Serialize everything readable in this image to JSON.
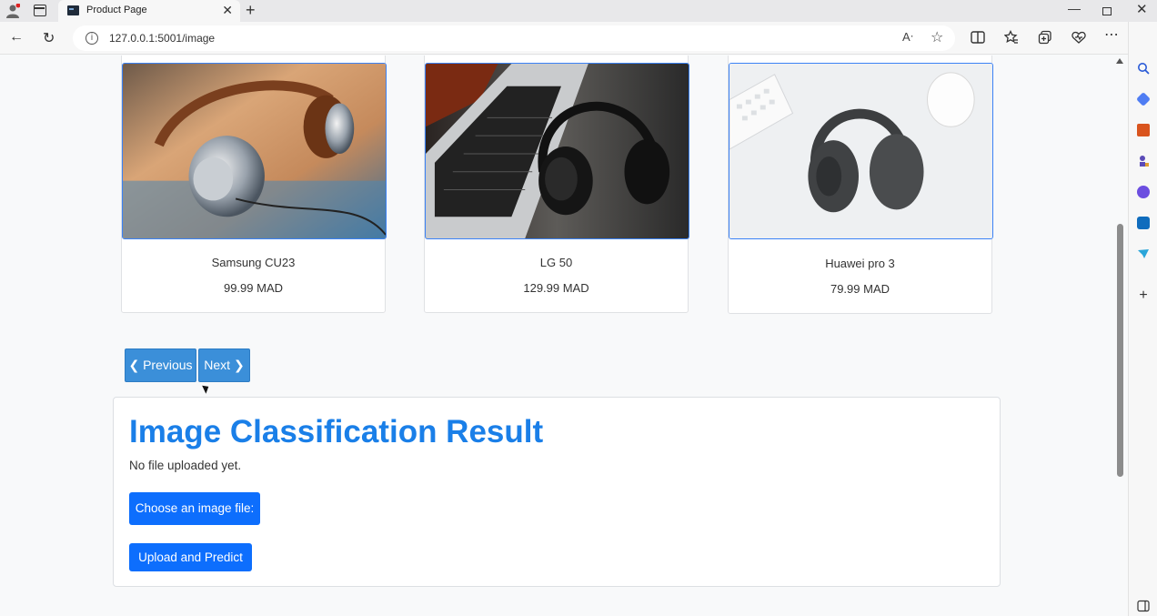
{
  "browser": {
    "tab_title": "Product Page",
    "url": "127.0.0.1:5001/image",
    "tab_close_glyph": "✕",
    "new_tab_glyph": "+",
    "window_controls": {
      "minimize": "—",
      "close": "✕"
    },
    "nav_glyphs": {
      "back": "←",
      "reload": "↻",
      "info": "i",
      "read_aloud": "Aᐧ",
      "favorite": "☆"
    }
  },
  "products": [
    {
      "name": "Samsung CU23",
      "price": "99.99 MAD"
    },
    {
      "name": "LG 50",
      "price": "129.99 MAD"
    },
    {
      "name": "Huawei pro 3",
      "price": "79.99 MAD"
    }
  ],
  "pagination": {
    "previous_label": "Previous",
    "next_label": "Next",
    "prev_glyph": "❮",
    "next_glyph": "❯"
  },
  "classification": {
    "title": "Image Classification Result",
    "status": "No file uploaded yet.",
    "choose_label": "Choose an image file:",
    "upload_label": "Upload and Predict"
  },
  "colors": {
    "accent": "#0d6efd",
    "title": "#1a7fe8",
    "pager": "#3b8fd9"
  }
}
